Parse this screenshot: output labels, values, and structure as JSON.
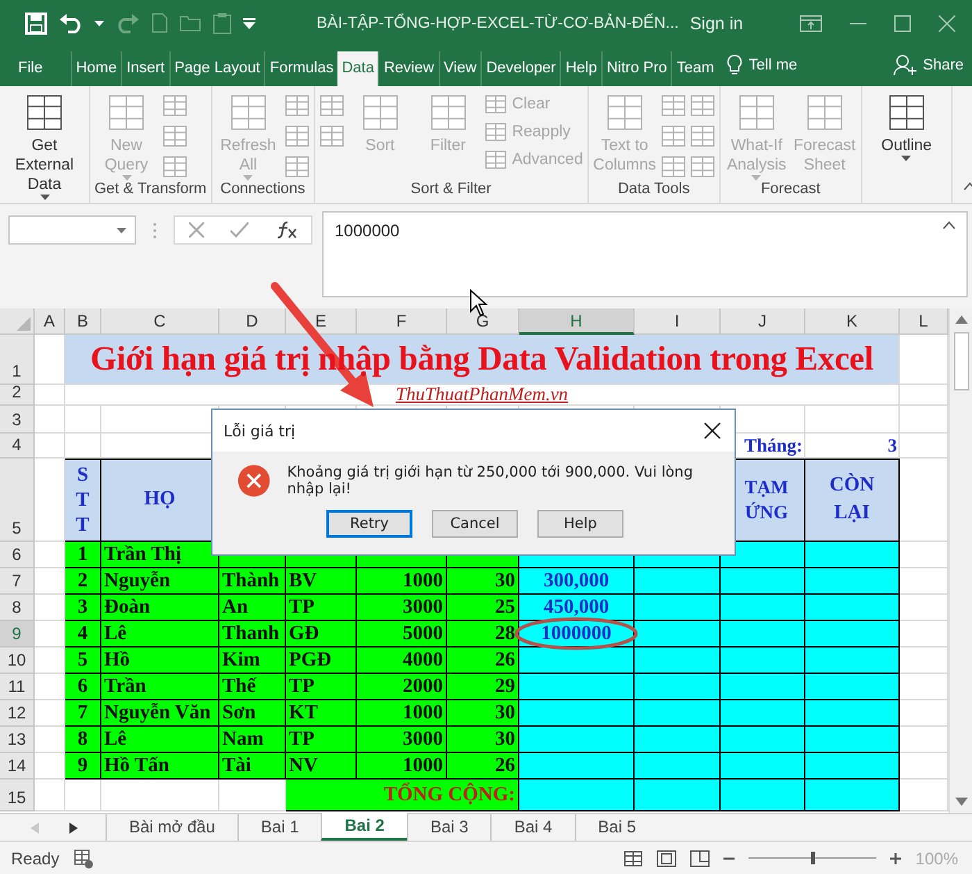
{
  "window": {
    "title": "BÀI-TẬP-TỔNG-HỢP-EXCEL-TỪ-CƠ-BẢN-ĐẾN...",
    "sign_in": "Sign in"
  },
  "ribbon_tabs": [
    {
      "label": "File",
      "selected": false
    },
    {
      "label": "Home",
      "selected": false
    },
    {
      "label": "Insert",
      "selected": false
    },
    {
      "label": "Page Layout",
      "selected": false
    },
    {
      "label": "Formulas",
      "selected": false
    },
    {
      "label": "Data",
      "selected": true
    },
    {
      "label": "Review",
      "selected": false
    },
    {
      "label": "View",
      "selected": false
    },
    {
      "label": "Developer",
      "selected": false
    },
    {
      "label": "Help",
      "selected": false
    },
    {
      "label": "Nitro Pro",
      "selected": false
    },
    {
      "label": "Team",
      "selected": false
    }
  ],
  "tell_me": "Tell me",
  "share": "Share",
  "ribbon_groups": [
    {
      "items": [
        {
          "kind": "large",
          "label": "Get External Data",
          "disabled": false,
          "dropdown": true
        }
      ]
    },
    {
      "label": "Get & Transform",
      "items": [
        {
          "kind": "large",
          "label": "New Query",
          "disabled": true,
          "dropdown": true
        },
        {
          "kind": "icon",
          "disabled": true
        },
        {
          "kind": "icon",
          "disabled": true
        },
        {
          "kind": "icon",
          "disabled": true
        }
      ]
    },
    {
      "label": "Connections",
      "items": [
        {
          "kind": "large",
          "label": "Refresh All",
          "disabled": true,
          "dropdown": true
        },
        {
          "kind": "icon",
          "disabled": true
        },
        {
          "kind": "icon",
          "disabled": true
        },
        {
          "kind": "icon",
          "disabled": true
        }
      ]
    },
    {
      "label": "Sort & Filter",
      "items": [
        {
          "kind": "icon",
          "disabled": true
        },
        {
          "kind": "icon",
          "disabled": true
        },
        {
          "kind": "large",
          "label": "Sort",
          "disabled": true,
          "dropdown": false
        },
        {
          "kind": "large",
          "label": "Filter",
          "disabled": true,
          "dropdown": false
        },
        {
          "kind": "small",
          "label": "Clear",
          "disabled": true
        },
        {
          "kind": "small",
          "label": "Reapply",
          "disabled": true
        },
        {
          "kind": "small",
          "label": "Advanced",
          "disabled": true
        }
      ]
    },
    {
      "label": "Data Tools",
      "items": [
        {
          "kind": "large",
          "label": "Text to Columns",
          "disabled": true,
          "dropdown": false
        },
        {
          "kind": "icon",
          "disabled": true
        },
        {
          "kind": "icon",
          "disabled": true
        },
        {
          "kind": "icon",
          "disabled": true
        },
        {
          "kind": "icon",
          "disabled": true
        },
        {
          "kind": "icon",
          "disabled": true
        },
        {
          "kind": "icon",
          "disabled": true
        }
      ]
    },
    {
      "label": "Forecast",
      "items": [
        {
          "kind": "large",
          "label": "What-If Analysis",
          "disabled": true,
          "dropdown": true
        },
        {
          "kind": "large",
          "label": "Forecast Sheet",
          "disabled": true,
          "dropdown": false
        }
      ]
    },
    {
      "items": [
        {
          "kind": "large",
          "label": "Outline",
          "disabled": false,
          "dropdown": true
        }
      ]
    }
  ],
  "formula_bar": {
    "value": "1000000"
  },
  "columns": [
    {
      "label": "A",
      "selected": false
    },
    {
      "label": "B",
      "selected": false
    },
    {
      "label": "C",
      "selected": false
    },
    {
      "label": "D",
      "selected": false
    },
    {
      "label": "E",
      "selected": false
    },
    {
      "label": "F",
      "selected": false
    },
    {
      "label": "G",
      "selected": false
    },
    {
      "label": "H",
      "selected": true
    },
    {
      "label": "I",
      "selected": false
    },
    {
      "label": "J",
      "selected": false
    },
    {
      "label": "K",
      "selected": false
    },
    {
      "label": "L",
      "selected": false
    }
  ],
  "rows": [
    {
      "number": "1",
      "selected": false,
      "kind": "title",
      "text": "Giới hạn giá trị nhập bằng Data Validation trong Excel"
    },
    {
      "number": "2",
      "selected": false,
      "kind": "link",
      "text": "ThuThuatPhanMem.vn"
    },
    {
      "number": "3",
      "selected": false,
      "kind": "blank"
    },
    {
      "number": "4",
      "selected": false,
      "kind": "month",
      "label": "Tháng:",
      "value": "3"
    },
    {
      "number": "5",
      "selected": false,
      "kind": "header",
      "cells": [
        {
          "text": "STT"
        },
        {
          "text": "HỌ"
        },
        {},
        {},
        {},
        {},
        {},
        {},
        {
          "text": "TẠM ỨNG"
        },
        {
          "text": "CÒN LẠI"
        }
      ]
    },
    {
      "number": "6",
      "selected": false,
      "kind": "data",
      "circled": false,
      "cells": [
        "1",
        "Trần Thị"
      ]
    },
    {
      "number": "7",
      "selected": false,
      "kind": "data",
      "circled": false,
      "cells": [
        "2",
        "Nguyễn",
        "Thành",
        "BV",
        "1000",
        "30",
        "300,000"
      ]
    },
    {
      "number": "8",
      "selected": false,
      "kind": "data",
      "circled": false,
      "cells": [
        "3",
        "Đoàn",
        "An",
        "TP",
        "3000",
        "25",
        "450,000"
      ]
    },
    {
      "number": "9",
      "selected": true,
      "kind": "data",
      "circled": true,
      "cells": [
        "4",
        "Lê",
        "Thanh",
        "GĐ",
        "5000",
        "28",
        "1000000"
      ]
    },
    {
      "number": "10",
      "selected": false,
      "kind": "data",
      "circled": false,
      "cells": [
        "5",
        "Hồ",
        "Kim",
        "PGĐ",
        "4000",
        "26"
      ]
    },
    {
      "number": "11",
      "selected": false,
      "kind": "data",
      "circled": false,
      "cells": [
        "6",
        "Trần",
        "Thế",
        "TP",
        "2000",
        "29"
      ]
    },
    {
      "number": "12",
      "selected": false,
      "kind": "data",
      "circled": false,
      "cells": [
        "7",
        "Nguyễn Văn",
        "Sơn",
        "KT",
        "1000",
        "30"
      ]
    },
    {
      "number": "13",
      "selected": false,
      "kind": "data",
      "circled": false,
      "cells": [
        "8",
        "Lê",
        "Nam",
        "TP",
        "3000",
        "30"
      ]
    },
    {
      "number": "14",
      "selected": false,
      "kind": "data",
      "circled": false,
      "cells": [
        "9",
        "Hồ Tấn",
        "Tài",
        "NV",
        "1000",
        "26"
      ]
    },
    {
      "number": "15",
      "selected": false,
      "kind": "total",
      "label": "TỔNG CỘNG:"
    }
  ],
  "dialog": {
    "title": "Lỗi giá trị",
    "message": "Khoảng giá trị giới hạn từ 250,000 tới 900,000. Vui lòng nhập lại!",
    "buttons": [
      {
        "label": "Retry",
        "default": true
      },
      {
        "label": "Cancel",
        "default": false
      },
      {
        "label": "Help",
        "default": false
      }
    ]
  },
  "annotations": [
    {
      "kind": "arrow"
    }
  ],
  "sheet_tabs": [
    {
      "label": "Bài mở đầu",
      "selected": false
    },
    {
      "label": "Bai 1",
      "selected": false
    },
    {
      "label": "Bai 2",
      "selected": true
    },
    {
      "label": "Bai 3",
      "selected": false
    },
    {
      "label": "Bai 4",
      "selected": false
    },
    {
      "label": "Bai 5",
      "selected": false
    }
  ],
  "status_bar": {
    "text": "Ready",
    "zoom": "100%",
    "zoom_slider": {
      "level": 0.5
    }
  }
}
